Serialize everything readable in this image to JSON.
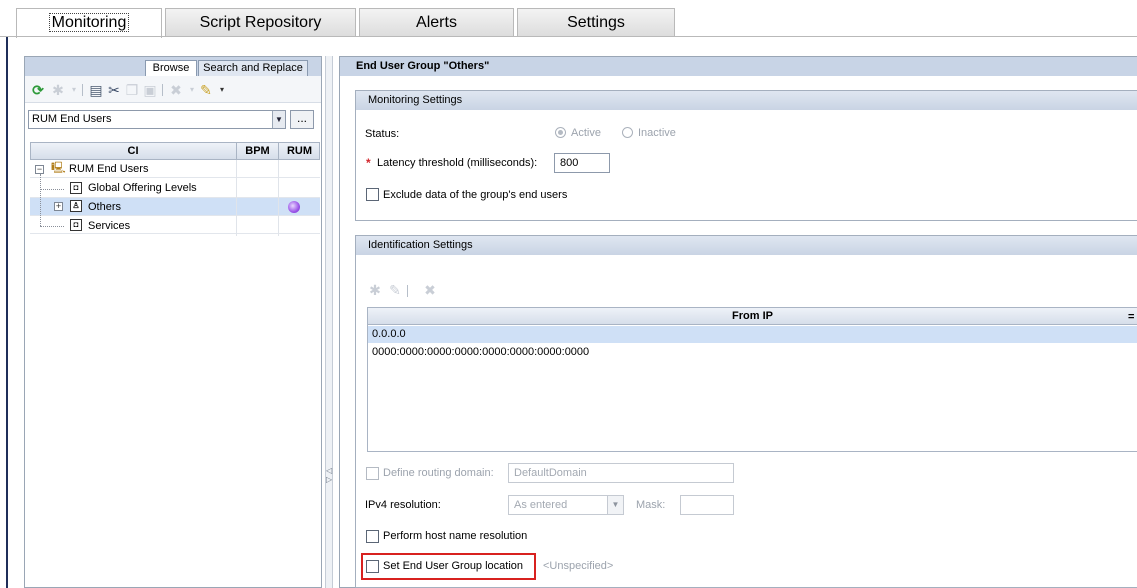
{
  "tabs": [
    "Monitoring",
    "Script Repository",
    "Alerts",
    "Settings"
  ],
  "left_panel": {
    "subtabs": [
      "Browse",
      "Search and Replace"
    ],
    "view_select": "RUM End Users",
    "ellipsis": "...",
    "tree_columns": [
      "CI",
      "BPM",
      "RUM"
    ],
    "tree": [
      {
        "label": "RUM End Users"
      },
      {
        "label": "Global Offering Levels"
      },
      {
        "label": "Others"
      },
      {
        "label": "Services"
      }
    ]
  },
  "right_panel": {
    "title": "End User Group \"Others\"",
    "monitoring": {
      "title": "Monitoring Settings",
      "status_label": "Status:",
      "status_options": [
        "Active",
        "Inactive"
      ],
      "latency_label": "Latency threshold (milliseconds):",
      "latency_value": "800",
      "exclude_label": "Exclude data of the group's end users"
    },
    "identification": {
      "title": "Identification Settings",
      "grid_header": "From IP",
      "grid_header_extra": "=",
      "rows": [
        "0.0.0.0",
        "0000:0000:0000:0000:0000:0000:0000:0000"
      ],
      "routing_label": "Define routing domain:",
      "routing_value": "DefaultDomain",
      "ipv4_label": "IPv4 resolution:",
      "ipv4_value": "As entered",
      "mask_label": "Mask:",
      "host_label": "Perform host name resolution",
      "location_label": "Set End User Group location",
      "location_value": "<Unspecified>"
    }
  },
  "colors": {
    "title_bar": "#c8d4e6",
    "selection": "#cfe0f6",
    "highlight": "#d8211f"
  }
}
